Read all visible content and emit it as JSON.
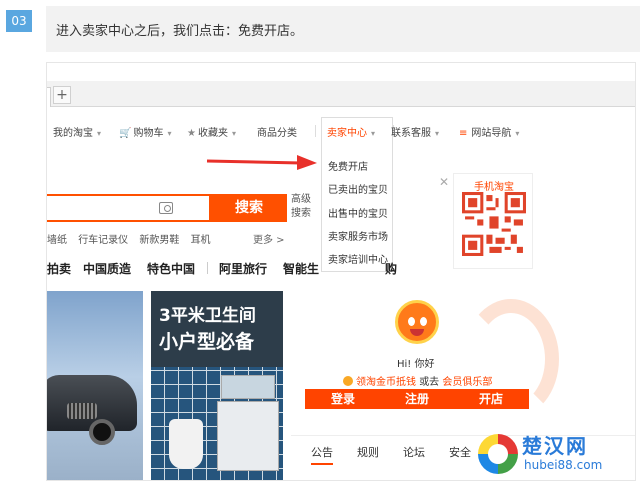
{
  "step": {
    "number": "03",
    "instruction": "进入卖家中心之后，我们点击：免费开店。"
  },
  "browser": {
    "new_tab_label": "+"
  },
  "site_nav": {
    "items": [
      "我的淘宝",
      "购物车",
      "收藏夹",
      "商品分类",
      "卖家中心",
      "联系客服",
      "网站导航"
    ]
  },
  "seller_dropdown": {
    "items": [
      "免费开店",
      "已卖出的宝贝",
      "出售中的宝贝",
      "卖家服务市场",
      "卖家培训中心"
    ]
  },
  "search": {
    "button_label": "搜索",
    "advanced_label": "高级搜索",
    "hot_words": [
      "墙纸",
      "行车记录仪",
      "新款男鞋",
      "耳机"
    ],
    "more_label": "更多 >"
  },
  "main_nav": {
    "items": [
      "拍卖",
      "中国质造",
      "特色中国",
      "阿里旅行",
      "智能生",
      "购"
    ]
  },
  "qr": {
    "title": "手机淘宝",
    "close": "✕"
  },
  "banners": {
    "bath_line1": "3平米卫生间",
    "bath_line2": "小户型必备"
  },
  "user_panel": {
    "greeting": "Hi! 你好",
    "coin_link": "领淘金币抵钱",
    "coin_mid": "或去",
    "club_link": "会员俱乐部",
    "login_label": "登录",
    "register_label": "注册",
    "open_shop_label": "开店"
  },
  "notice_tabs": [
    "公告",
    "规则",
    "论坛",
    "安全"
  ],
  "watermark": {
    "title": "楚汉网",
    "url": "hubei88.com"
  },
  "colors": {
    "accent": "#ff5000",
    "step_badge": "#5aa7e0",
    "watermark": "#2a7bd8"
  }
}
